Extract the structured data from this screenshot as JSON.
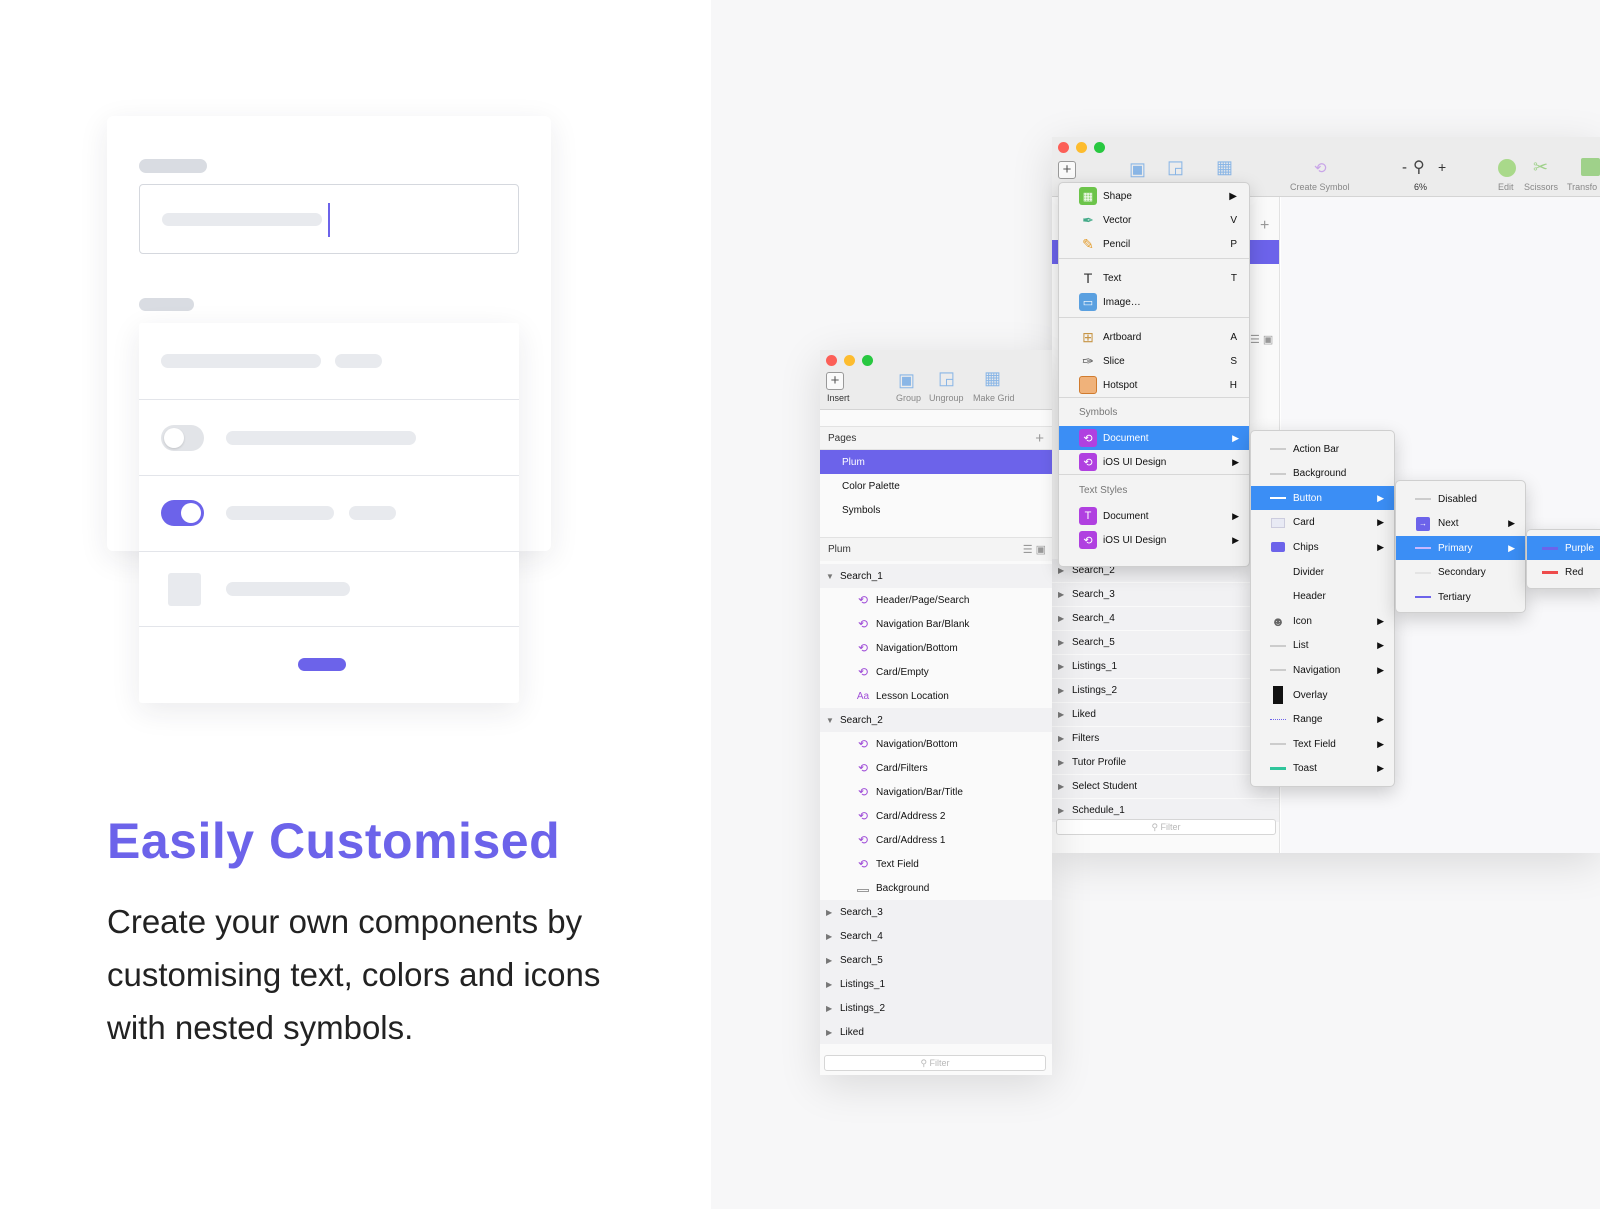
{
  "headline": "Easily Customised",
  "description": "Create your own components by customising text, colors and icons with nested symbols.",
  "colors": {
    "accent": "#6c63ea",
    "selection_purple": "#6c63ea",
    "menu_selection": "#3b8ef5"
  },
  "front_window": {
    "toolbar": {
      "insert": "Insert",
      "group": "Group",
      "ungroup": "Ungroup",
      "make_grid": "Make Grid"
    },
    "pages_header": "Pages",
    "pages": [
      "Plum",
      "Color Palette",
      "Symbols"
    ],
    "layers_header": "Plum",
    "groups": [
      {
        "name": "Search_1",
        "children": [
          "Header/Page/Search",
          "Navigation Bar/Blank",
          "Navigation/Bottom",
          "Card/Empty",
          "Lesson Location"
        ]
      },
      {
        "name": "Search_2",
        "children": [
          "Navigation/Bottom",
          "Card/Filters",
          "Navigation/Bar/Title",
          "Card/Address 2",
          "Card/Address 1",
          "Text Field",
          "Background"
        ]
      }
    ],
    "collapsed": [
      "Search_3",
      "Search_4",
      "Search_5",
      "Listings_1",
      "Listings_2",
      "Liked"
    ],
    "text_icon": "Aa",
    "filter_placeholder": "Filter"
  },
  "back_window": {
    "toolbar": {
      "create_symbol": "Create Symbol",
      "zoom_minus": "-",
      "zoom_plus": "+",
      "zoom": "6%",
      "edit": "Edit",
      "scissors": "Scissors",
      "transform": "Transfo"
    },
    "list": [
      "Search_2",
      "Search_3",
      "Search_4",
      "Search_5",
      "Listings_1",
      "Listings_2",
      "Liked",
      "Filters",
      "Tutor Profile",
      "Select Student",
      "Schedule_1"
    ],
    "filter_placeholder": "Filter"
  },
  "insert_menu": {
    "items": [
      {
        "label": "Shape",
        "shortcut": "▶"
      },
      {
        "label": "Vector",
        "shortcut": "V"
      },
      {
        "label": "Pencil",
        "shortcut": "P"
      },
      {
        "label": "Text",
        "shortcut": "T"
      },
      {
        "label": "Image…",
        "shortcut": ""
      },
      {
        "label": "Artboard",
        "shortcut": "A"
      },
      {
        "label": "Slice",
        "shortcut": "S"
      },
      {
        "label": "Hotspot",
        "shortcut": "H"
      }
    ],
    "symbols_header": "Symbols",
    "symbols": [
      "Document",
      "iOS UI Design"
    ],
    "text_styles_header": "Text Styles",
    "text_styles": [
      "Document",
      "iOS UI Design"
    ],
    "arrow": "▶"
  },
  "document_menu": [
    "Action Bar",
    "Background",
    "Button",
    "Card",
    "Chips",
    "Divider",
    "Header",
    "Icon",
    "List",
    "Navigation",
    "Overlay",
    "Range",
    "Text Field",
    "Toast"
  ],
  "button_menu": [
    "Disabled",
    "Next",
    "Primary",
    "Secondary",
    "Tertiary"
  ],
  "primary_menu": [
    "Purple",
    "Red"
  ]
}
